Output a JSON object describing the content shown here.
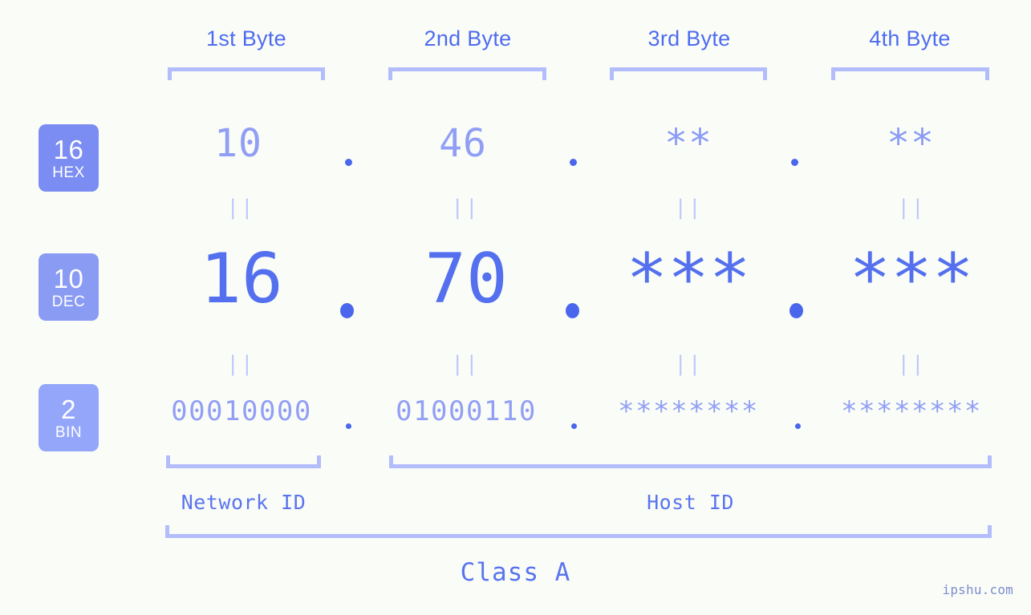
{
  "page": {
    "background_color": "#fafdf7",
    "accent_color": "#5570ee",
    "light_accent_color": "#b3bdfb",
    "watermark": "ipshu.com"
  },
  "byte_headers": [
    {
      "label": "1st Byte"
    },
    {
      "label": "2nd Byte"
    },
    {
      "label": "3rd Byte"
    },
    {
      "label": "4th Byte"
    }
  ],
  "rows": [
    {
      "badge_number": "16",
      "badge_name": "HEX",
      "badge_color": "#7b8df2",
      "values": [
        "10",
        "46",
        "**",
        "**"
      ],
      "separator": "."
    },
    {
      "badge_number": "10",
      "badge_name": "DEC",
      "badge_color": "#8a9bf4",
      "values": [
        "16",
        "70",
        "***",
        "***"
      ],
      "separator": "."
    },
    {
      "badge_number": "2",
      "badge_name": "BIN",
      "badge_color": "#94a6fa",
      "values": [
        "00010000",
        "01000110",
        "********",
        "********"
      ],
      "separator": "."
    }
  ],
  "equals_marks": {
    "symbol": "||"
  },
  "id_sections": [
    {
      "label": "Network ID"
    },
    {
      "label": "Host ID"
    }
  ],
  "class_label": "Class A"
}
